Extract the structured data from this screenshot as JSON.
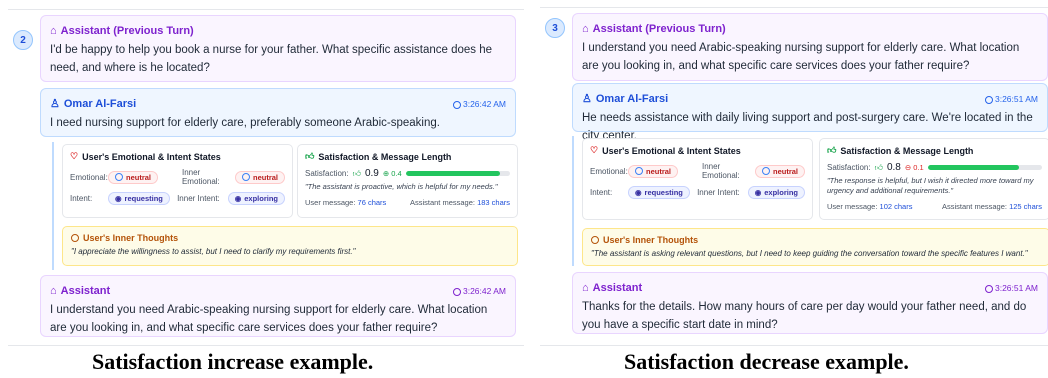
{
  "left": {
    "turn": "2",
    "prev_assistant": {
      "label": "Assistant (Previous Turn)",
      "text": "I'd be happy to help you book a nurse for your father. What specific assistance does he need, and where is he located?"
    },
    "user": {
      "name": "Omar Al-Farsi",
      "time": "3:26:42 AM",
      "text": "I need nursing support for elderly care, preferably someone Arabic-speaking."
    },
    "states": {
      "title": "User's Emotional & Intent States",
      "emotional_label": "Emotional:",
      "emotional": "neutral",
      "inner_emotional_label": "Inner Emotional:",
      "inner_emotional": "neutral",
      "intent_label": "Intent:",
      "intent": "requesting",
      "inner_intent_label": "Inner Intent:",
      "inner_intent": "exploring"
    },
    "satisfaction": {
      "title": "Satisfaction & Message Length",
      "label": "Satisfaction:",
      "value": "0.9",
      "delta": "0.4",
      "level": 0.9,
      "quote": "\"The assistant is proactive, which is helpful for my needs.\"",
      "user_msg_label": "User message:",
      "user_msg": "76 chars",
      "assistant_msg_label": "Assistant message:",
      "assistant_msg": "183 chars"
    },
    "thoughts": {
      "title": "User's Inner Thoughts",
      "text": "\"I appreciate the willingness to assist, but I need to clarify my requirements first.\""
    },
    "assistant": {
      "label": "Assistant",
      "time": "3:26:42 AM",
      "text": "I understand you need Arabic-speaking nursing support for elderly care. What location are you looking in, and what specific care services does your father require?"
    },
    "caption": "Satisfaction increase example."
  },
  "right": {
    "turn": "3",
    "prev_assistant": {
      "label": "Assistant (Previous Turn)",
      "text": "I understand you need Arabic-speaking nursing support for elderly care. What location are you looking in, and what specific care services does your father require?"
    },
    "user": {
      "name": "Omar Al-Farsi",
      "time": "3:26:51 AM",
      "text": "He needs assistance with daily living support and post-surgery care. We're located in the city center."
    },
    "states": {
      "title": "User's Emotional & Intent States",
      "emotional_label": "Emotional:",
      "emotional": "neutral",
      "inner_emotional_label": "Inner Emotional:",
      "inner_emotional": "neutral",
      "intent_label": "Intent:",
      "intent": "requesting",
      "inner_intent_label": "Inner Intent:",
      "inner_intent": "exploring"
    },
    "satisfaction": {
      "title": "Satisfaction & Message Length",
      "label": "Satisfaction:",
      "value": "0.8",
      "delta": "0.1",
      "level": 0.8,
      "quote": "\"The response is helpful, but I wish it directed more toward my urgency and additional requirements.\"",
      "user_msg_label": "User message:",
      "user_msg": "102 chars",
      "assistant_msg_label": "Assistant message:",
      "assistant_msg": "125 chars"
    },
    "thoughts": {
      "title": "User's Inner Thoughts",
      "text": "\"The assistant is asking relevant questions, but I need to keep guiding the conversation toward the specific features I want.\""
    },
    "assistant": {
      "label": "Assistant",
      "time": "3:26:51 AM",
      "text": "Thanks for the details. How many hours of care per day would your father need, and do you have a specific start date in mind?"
    },
    "caption": "Satisfaction decrease example."
  },
  "colors": {
    "assistant": "#7e22ce",
    "user": "#1d4ed8",
    "satisfaction_bar": "#22c55e",
    "delta_up": "#16a34a",
    "delta_down": "#dc2626",
    "thoughts": "#b45309"
  },
  "icons": {
    "assistant": "robot-icon",
    "user": "person-icon",
    "clock": "clock-icon",
    "heart": "heart-icon",
    "thumbs": "thumbs-up-icon",
    "alert": "alert-circle-icon",
    "smile": "neutral-face-icon",
    "intent": "target-icon"
  }
}
